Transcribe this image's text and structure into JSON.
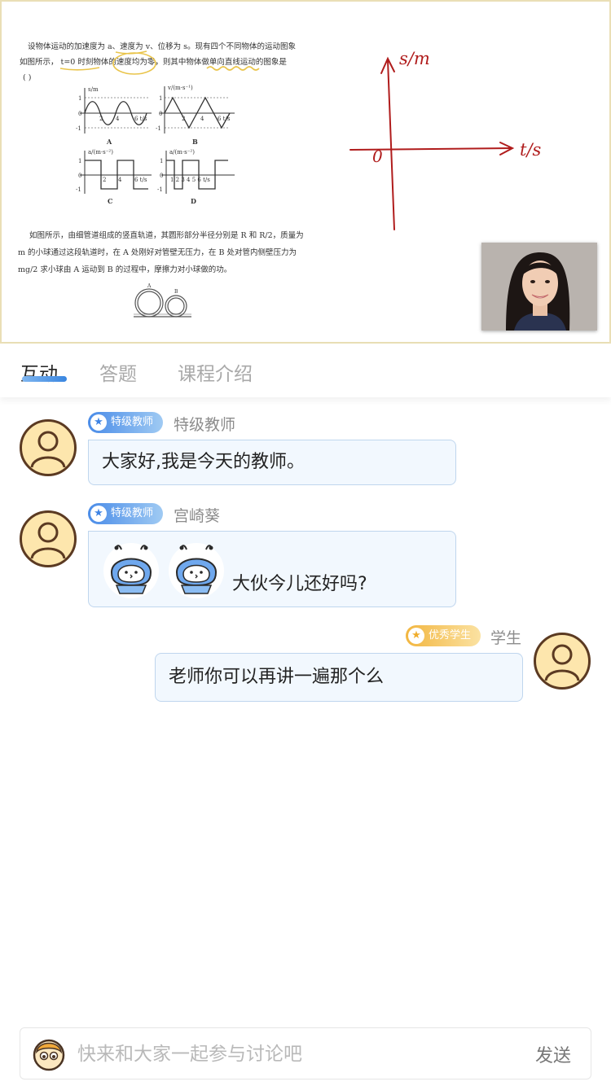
{
  "whiteboard": {
    "question1_line1": "设物体运动的加速度为 a、速度为 v、位移为 s。现有四个不同物体的运动图象",
    "question1_line2": "如图所示，  t=0 时刻物体的速度均为零，则其中物体做单向直线运动的图象是",
    "question1_line3": "(      )",
    "option_a": "A",
    "option_b": "B",
    "option_c": "C",
    "option_d": "D",
    "question2_line1": "如图所示，由细管道组成的竖直轨道，其圆形部分半径分别是 R 和 R/2，质量为",
    "question2_line2": "m 的小球通过这段轨道时，在 A 处刚好对管壁无压力，在 B 处对管内侧壁压力为",
    "question2_line3": "mg/2 求小球由 A 运动到 B 的过程中，摩擦力对小球做的功。",
    "handwritten_y_label": "s/m",
    "handwritten_x_label": "t/s",
    "handwritten_origin": "0"
  },
  "tabs": [
    {
      "label": "互动",
      "active": true
    },
    {
      "label": "答题",
      "active": false
    },
    {
      "label": "课程介绍",
      "active": false
    }
  ],
  "messages": [
    {
      "side": "left",
      "badge": "特级教师",
      "name": "特级教师",
      "text": "大家好,我是今天的教师。"
    },
    {
      "side": "left",
      "badge": "特级教师",
      "name": "宫崎葵",
      "text": "大伙今儿还好吗?",
      "emojis": [
        "robot-face",
        "robot-face"
      ]
    },
    {
      "side": "right",
      "badge": "优秀学生",
      "name": "学生",
      "text": "老师你可以再讲一遍那个么"
    }
  ],
  "input": {
    "placeholder": "快来和大家一起参与讨论吧",
    "send_label": "发送"
  },
  "colors": {
    "accent_blue": "#3a86e0",
    "teacher_badge": "#4a8ce8",
    "student_badge": "#f2b640",
    "handwriting_red": "#b01c1c",
    "bubble_bg": "#f2f8fe"
  }
}
